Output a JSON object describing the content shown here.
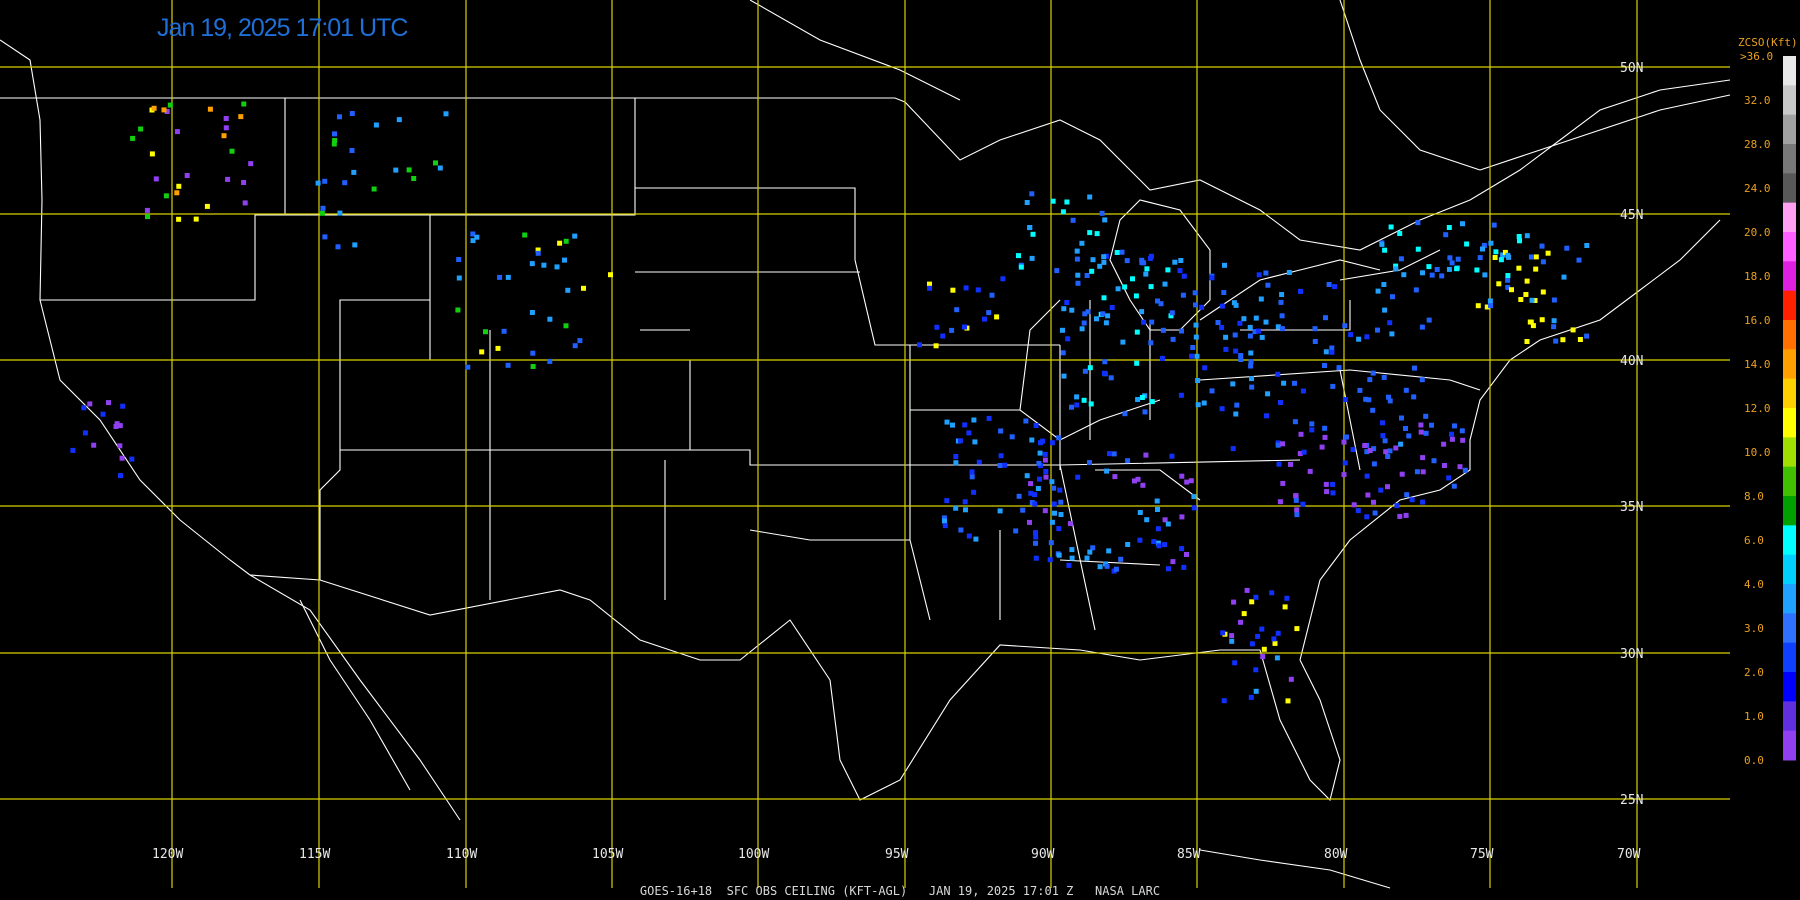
{
  "header": {
    "timestamp": "Jan 19, 2025 17:01 UTC"
  },
  "footer": {
    "caption": "GOES-16+18  SFC OBS CEILING (KFT-AGL)   JAN 19, 2025 17:01 Z   NASA LARC"
  },
  "map": {
    "grid_color": "#d8d000",
    "border_color": "#ffffff",
    "longitude_labels": [
      "120W",
      "115W",
      "110W",
      "105W",
      "100W",
      "95W",
      "90W",
      "85W",
      "80W",
      "75W",
      "70W"
    ],
    "latitude_labels": [
      "50N",
      "45N",
      "40N",
      "35N",
      "30N",
      "25N"
    ]
  },
  "colorbar": {
    "title": "ZCSO(Kft)",
    "top_label": ">36.0",
    "tick_labels": [
      "32.0",
      "28.0",
      "24.0",
      "20.0",
      "18.0",
      "16.0",
      "14.0",
      "12.0",
      "10.0",
      "8.0",
      "6.0",
      "4.0",
      "3.0",
      "2.0",
      "1.0",
      "0.0"
    ],
    "colors": [
      "#e8e8e8",
      "#c8c8c8",
      "#a0a0a0",
      "#787878",
      "#585858",
      "#ffa0f0",
      "#ff60ff",
      "#e020e0",
      "#ff2000",
      "#ff7000",
      "#ffa000",
      "#ffd000",
      "#ffff00",
      "#a0e000",
      "#40c000",
      "#00a000",
      "#00ffff",
      "#00d0ff",
      "#20a0ff",
      "#3070ff",
      "#1040ff",
      "#0000ff",
      "#6030e0",
      "#9040f0"
    ]
  },
  "observations": {
    "color_key": {
      "violet": "#9040f0",
      "blue": "#1030ff",
      "mid_blue": "#2060ff",
      "sky": "#20a0ff",
      "cyan": "#00ffff",
      "green": "#10d010",
      "yellow_green": "#a0e000",
      "yellow": "#ffff00",
      "orange": "#ffa000",
      "red": "#ff2000",
      "pink": "#ff80ff"
    }
  }
}
